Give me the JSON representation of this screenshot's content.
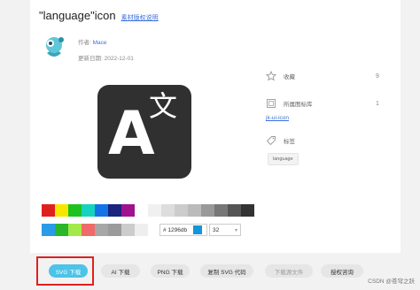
{
  "title": "\"language\"icon",
  "copyright_link": "素材版权说明",
  "author": {
    "label": "作者:",
    "name": "Mace"
  },
  "updated": {
    "label": "更新日期:",
    "date": "2022-12-01"
  },
  "icon": {
    "glyph_latin": "A",
    "glyph_cjk": "文",
    "background": "#303030"
  },
  "palette": {
    "row1": [
      "#e02020",
      "#f7e700",
      "#1ec21e",
      "#16d3c0",
      "#1473e6",
      "#1a237e",
      "#a0118f",
      "#ffffff",
      "#f0f0f0",
      "#dddddd",
      "#cccccc",
      "#bbbbbb",
      "#999999",
      "#777777",
      "#555555",
      "#333333"
    ],
    "row2": [
      "#2b9be8",
      "#2bb62b",
      "#a4e94a",
      "#f06a6a",
      "#a7a7a7",
      "#9b9b9b",
      "#cccccc",
      "#eeeeee"
    ]
  },
  "color_input": {
    "value": "# 1296db",
    "preview": "#1296db"
  },
  "size_select": {
    "value": "32"
  },
  "sidebar": {
    "favorites": {
      "label": "收藏",
      "count": "9"
    },
    "library": {
      "label": "所属图标库",
      "count": "1",
      "link": "jk-ui-icon"
    },
    "tags": {
      "label": "标签",
      "items": [
        "language"
      ]
    }
  },
  "buttons": {
    "svg": "SVG 下载",
    "ai": "AI 下载",
    "png": "PNG 下载",
    "copy_svg": "复制 SVG 代码",
    "source": "下载源文件",
    "license": "授权咨询"
  },
  "watermark": "CSDN @苍穹之跃"
}
